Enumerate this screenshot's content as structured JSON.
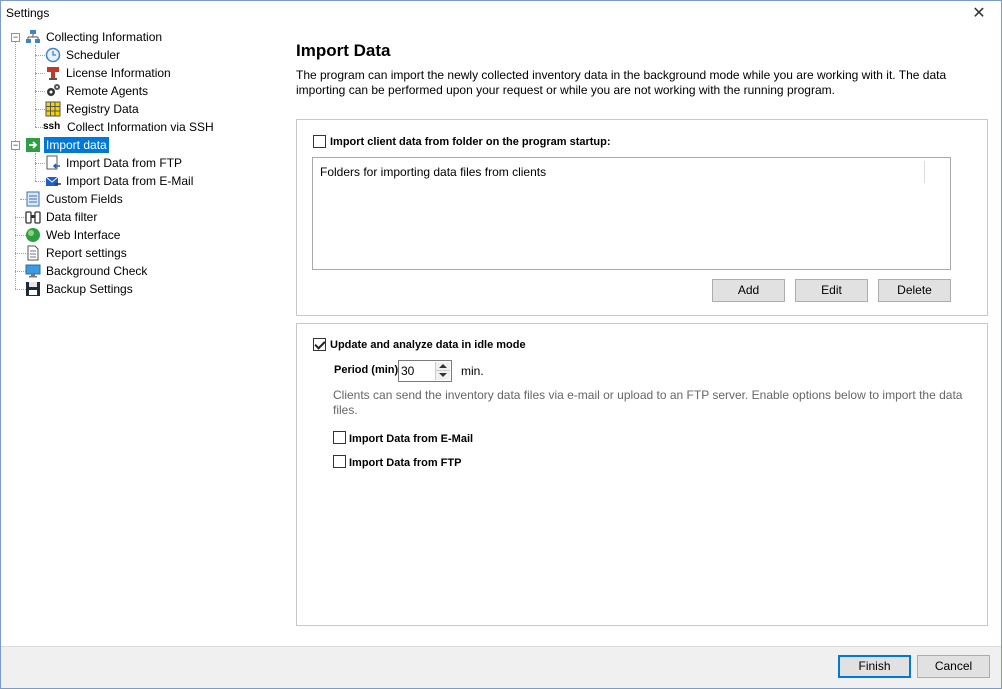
{
  "window": {
    "title": "Settings"
  },
  "tree": {
    "items": [
      {
        "label": "Collecting Information",
        "icon": "network-icon"
      },
      {
        "label": "Scheduler",
        "icon": "clock-icon"
      },
      {
        "label": "License Information",
        "icon": "stamp-icon"
      },
      {
        "label": "Remote Agents",
        "icon": "gears-icon"
      },
      {
        "label": "Registry Data",
        "icon": "grid-icon"
      },
      {
        "label": "Collect Information via SSH",
        "icon": "ssh-icon",
        "icon_text": "ssh"
      },
      {
        "label": "Import data",
        "icon": "import-icon"
      },
      {
        "label": "Import Data from FTP",
        "icon": "ftp-import-icon"
      },
      {
        "label": "Import Data from E-Mail",
        "icon": "email-import-icon"
      },
      {
        "label": "Custom Fields",
        "icon": "form-icon"
      },
      {
        "label": "Data filter",
        "icon": "binoculars-icon"
      },
      {
        "label": "Web Interface",
        "icon": "globe-icon"
      },
      {
        "label": "Report settings",
        "icon": "report-icon"
      },
      {
        "label": "Background Check",
        "icon": "monitor-icon"
      },
      {
        "label": "Backup Settings",
        "icon": "floppy-icon"
      }
    ],
    "selected": "Import data"
  },
  "main": {
    "title": "Import Data",
    "description": "The program can import the newly collected inventory data in the background mode while you are working with it. The data importing can be performed upon your request or while you are not working with the running program.",
    "folder_group": {
      "checkbox_label": "Import client data from folder on the program startup:",
      "checked": false,
      "list_header": "Folders for importing data files from clients",
      "add_label": "Add",
      "edit_label": "Edit",
      "delete_label": "Delete"
    },
    "idle_group": {
      "checkbox_label": "Update and analyze data in idle mode",
      "checked": true,
      "period_label": "Period (min)",
      "period_value": "30",
      "period_unit": "min.",
      "info": "Clients can send the inventory data files via e-mail or upload to an FTP server. Enable options below to import the data files.",
      "email_label": "Import Data from E-Mail",
      "email_checked": false,
      "ftp_label": "Import Data from FTP",
      "ftp_checked": false
    }
  },
  "footer": {
    "finish_label": "Finish",
    "cancel_label": "Cancel"
  }
}
